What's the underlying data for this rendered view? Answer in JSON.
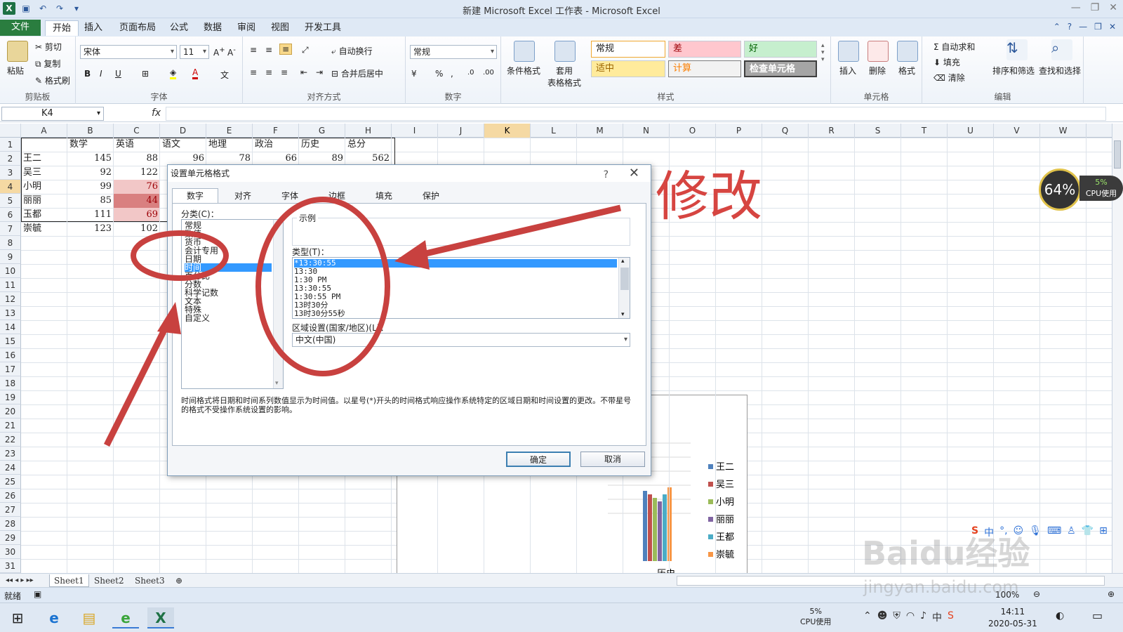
{
  "window": {
    "title": "新建 Microsoft Excel 工作表 - Microsoft Excel"
  },
  "ribbon_tabs": [
    "文件",
    "开始",
    "插入",
    "页面布局",
    "公式",
    "数据",
    "审阅",
    "视图",
    "开发工具"
  ],
  "clipboard": {
    "paste": "粘贴",
    "cut": "剪切",
    "copy": "复制",
    "painter": "格式刷",
    "label": "剪贴板"
  },
  "font": {
    "name": "宋体",
    "size": "11",
    "label": "字体"
  },
  "alignment": {
    "wrap": "自动换行",
    "merge": "合并后居中",
    "label": "对齐方式"
  },
  "number": {
    "format": "常规",
    "label": "数字"
  },
  "styles": {
    "cond": "条件格式",
    "table": "套用\n表格格式",
    "normal": "常规",
    "bad": "差",
    "good": "好",
    "neutral": "适中",
    "calc": "计算",
    "check": "检查单元格",
    "label": "样式"
  },
  "cells": {
    "insert": "插入",
    "delete": "删除",
    "format": "格式",
    "label": "单元格"
  },
  "editing": {
    "autosum": "自动求和",
    "fill": "填充",
    "clear": "清除",
    "sort": "排序和筛选",
    "find": "查找和选择",
    "label": "编辑"
  },
  "namebox": "K4",
  "fx": "fx",
  "columns": [
    "A",
    "B",
    "C",
    "D",
    "E",
    "F",
    "G",
    "H",
    "I",
    "J",
    "K",
    "L",
    "M",
    "N",
    "O",
    "P",
    "Q",
    "R",
    "S",
    "T",
    "U",
    "V",
    "W"
  ],
  "rows": [
    "1",
    "2",
    "3",
    "4",
    "5",
    "6",
    "7",
    "8",
    "9",
    "10",
    "11",
    "12",
    "13",
    "14",
    "15",
    "16",
    "17",
    "18",
    "19",
    "20",
    "21",
    "22",
    "23",
    "24",
    "25",
    "26",
    "27",
    "28",
    "29",
    "30",
    "31"
  ],
  "table": {
    "headers": [
      "",
      "数学",
      "英语",
      "语文",
      "地理",
      "政治",
      "历史",
      "总分"
    ],
    "rows": [
      [
        "王二",
        "145",
        "88",
        "96",
        "78",
        "66",
        "89",
        "562"
      ],
      [
        "吴三",
        "92",
        "122"
      ],
      [
        "小明",
        "99",
        "76"
      ],
      [
        "丽丽",
        "85",
        "44"
      ],
      [
        "玉都",
        "111",
        "69"
      ],
      [
        "崇毓",
        "123",
        "102"
      ]
    ]
  },
  "chart": {
    "legend": [
      "王二",
      "吴三",
      "小明",
      "丽丽",
      "王都",
      "崇毓"
    ],
    "xlabel": "历史",
    "colors": [
      "#4f81bd",
      "#c0504d",
      "#9bbb59",
      "#8064a2",
      "#4bacc6",
      "#f79646"
    ]
  },
  "sheets": [
    "Sheet1",
    "Sheet2",
    "Sheet3"
  ],
  "status": {
    "ready": "就绪",
    "zoom": "100%"
  },
  "dialog": {
    "title": "设置单元格格式",
    "help": "?",
    "close": "✕",
    "tabs": [
      "数字",
      "对齐",
      "字体",
      "边框",
      "填充",
      "保护"
    ],
    "category_label": "分类(C)：",
    "categories": [
      "常规",
      "数值",
      "货币",
      "会计专用",
      "日期",
      "时间",
      "百分比",
      "分数",
      "科学记数",
      "文本",
      "特殊",
      "自定义"
    ],
    "sample_label": "示例",
    "type_label": "类型(T)：",
    "types": [
      "*13:30:55",
      "13:30",
      "1:30 PM",
      "13:30:55",
      "1:30:55 PM",
      "13时30分",
      "13时30分55秒"
    ],
    "locale_label": "区域设置(国家/地区)(L)：",
    "locale": "中文(中国)",
    "description": "时间格式将日期和时间系列数值显示为时间值。以星号(*)开头的时间格式响应操作系统特定的区域日期和时间设置的更改。不带星号的格式不受操作系统设置的影响。",
    "ok": "确定",
    "cancel": "取消"
  },
  "annotation": {
    "text": "修改"
  },
  "cpu": {
    "percent": "64%",
    "usage": "5%",
    "label": "CPU使用"
  },
  "taskbar": {
    "cpu": "5%",
    "cpu_label": "CPU使用",
    "time": "14:11",
    "date": "2020-05-31",
    "ime": "中"
  },
  "watermark": {
    "brand": "Baidu经验",
    "url": "jingyan.baidu.com"
  }
}
